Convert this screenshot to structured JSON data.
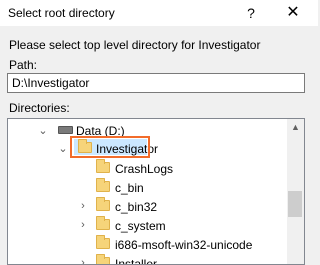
{
  "window": {
    "title": "Select root directory",
    "help_icon": "?",
    "close_icon": "✕"
  },
  "dialog": {
    "instruction": "Please select top level directory for Investigator",
    "path_label": "Path:",
    "path_value": "D:\\Investigator",
    "directories_label": "Directories:"
  },
  "tree": {
    "drive": "Data (D:)",
    "selected": "Investigator",
    "children": [
      "CrashLogs",
      "c_bin",
      "c_bin32",
      "c_system",
      "i686-msoft-win32-unicode",
      "Installer"
    ]
  }
}
